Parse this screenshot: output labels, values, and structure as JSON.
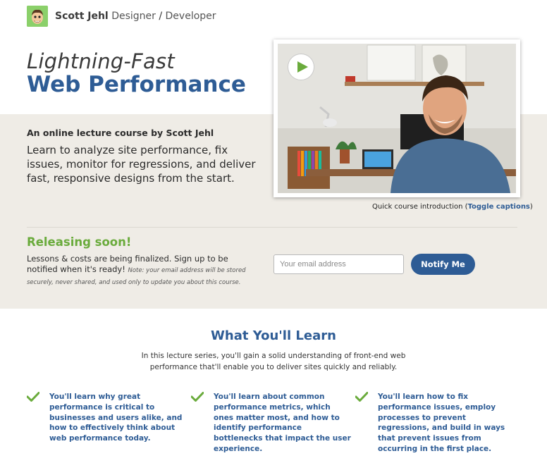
{
  "header": {
    "name": "Scott Jehl",
    "role_designer": "Designer",
    "slash": "/",
    "role_developer": "Developer"
  },
  "hero": {
    "title_line1": "Lightning-Fast",
    "title_line2": "Web Performance",
    "byline": "An online lecture course by Scott Jehl",
    "intro": "Learn to analyze site performance, fix issues, monitor for regressions, and deliver fast, responsive designs from the start."
  },
  "video": {
    "caption_prefix": "Quick course introduction (",
    "caption_link": "Toggle captions",
    "caption_suffix": ")"
  },
  "signup": {
    "heading": "Releasing soon!",
    "text": "Lessons & costs are being finalized. Sign up to be notified when it's ready! ",
    "note": "Note: your email address will be stored securely, never shared, and used only to update you about this course.",
    "email_placeholder": "Your email address",
    "button_label": "Notify Me"
  },
  "learn": {
    "title": "What You'll Learn",
    "subtitle": "In this lecture series, you'll gain a solid understanding of front-end web performance that'll enable you to deliver sites quickly and reliably.",
    "items": [
      "You'll learn why great performance is critical to businesses and users alike, and how to effectively think about web performance today.",
      "You'll learn about common performance metrics, which ones matter most, and how to identify performance bottlenecks that impact the user experience.",
      "You'll learn how to fix performance issues, employ processes to prevent regressions, and build in ways that prevent issues from occurring in the first place."
    ]
  },
  "colors": {
    "brand_blue": "#2e5c95",
    "accent_green": "#6aab3c",
    "band_bg": "#efece6"
  },
  "icons": {
    "play": "play-icon",
    "check": "check-icon",
    "avatar": "avatar-cartoon"
  }
}
